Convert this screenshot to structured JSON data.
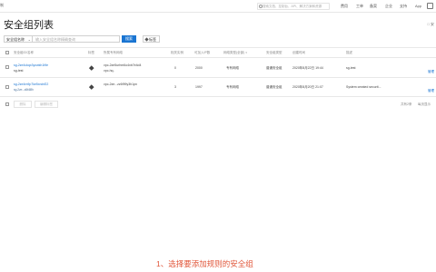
{
  "topbar": {
    "left_stub": "制",
    "search_placeholder": "搜索文档、控制台、API、解决方案和资源",
    "nav": [
      "费用",
      "工单",
      "备案",
      "企业",
      "支持",
      "App"
    ]
  },
  "page": {
    "title": "安全组列表",
    "right_link": "□ 安"
  },
  "filter": {
    "select_label": "安全组名称",
    "input_placeholder": "输入安全组名称精确查询",
    "search_button": "搜索",
    "tag_button": "标签"
  },
  "table": {
    "headers": [
      "安全组ID/名称",
      "标签",
      "所属专有网络",
      "相关实例",
      "可加入IP数",
      "网络类型(全部)",
      "安全组类型",
      "创建时间",
      "描述"
    ],
    "rows": [
      {
        "id": "sg-2ze4ckqx3ycwkh1t9e",
        "name": "sg-test",
        "vpc_id": "vpc-2ze5urhm6o4xb7e4d4",
        "vpc_name": "vpc-hq-",
        "instances": "0",
        "ip_capacity": "2000",
        "network_type": "专有网络",
        "sg_type": "普通安全组",
        "created": "2020年8月22日 19:44",
        "description": "sg-test",
        "ops": "管理"
      },
      {
        "id": "sg-2ze4m9p7ke5xrcbf22",
        "name": "sg-2ze...a5t4l8h",
        "vpc_id": "vpc-2ze...zz6f99y3h1pn",
        "vpc_name": "",
        "instances": "3",
        "ip_capacity": "1997",
        "network_type": "专有网络",
        "sg_type": "普通安全组",
        "created": "2020年8月20日 21:07",
        "description": "System created securit...",
        "ops": "管理"
      }
    ]
  },
  "bottom": {
    "btn_delete": "删除",
    "btn_edit_tag": "编辑标签",
    "pager_total": "共有2条",
    "pager_per_page": "每页显示"
  },
  "caption": "1、选择要添加规则的安全组",
  "colors": {
    "accent": "#1a75d2",
    "caption": "#e1573b"
  }
}
